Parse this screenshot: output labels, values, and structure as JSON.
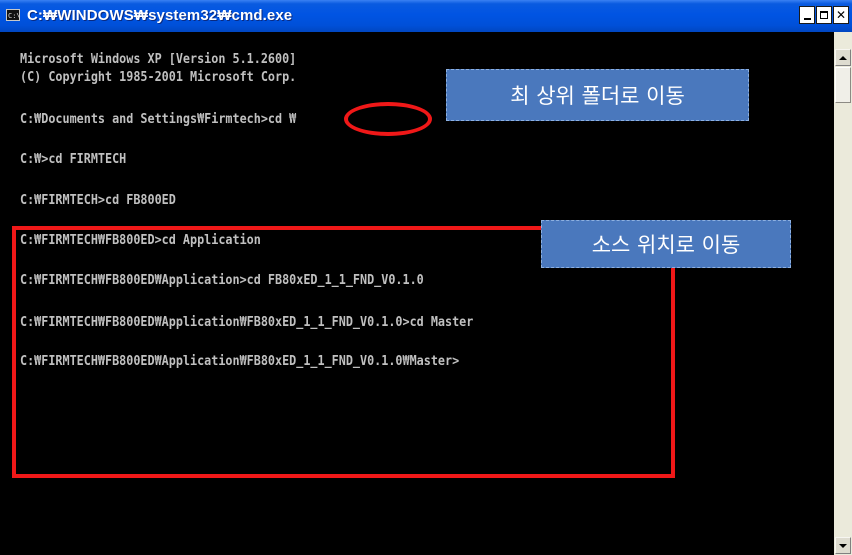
{
  "window": {
    "title": "C:₩WINDOWS₩system32₩cmd.exe",
    "app_icon_text": "C:\\",
    "controls": {
      "minimize": "minimize-icon",
      "maximize": "maximize-icon",
      "close": "close-icon"
    }
  },
  "console": {
    "lines": [
      "Microsoft Windows XP [Version 5.1.2600]",
      "(C) Copyright 1985-2001 Microsoft Corp.",
      "C:₩Documents and Settings₩Firmtech>cd ₩",
      "C:₩>cd FIRMTECH",
      "C:₩FIRMTECH>cd FB800ED",
      "C:₩FIRMTECH₩FB800ED>cd Application",
      "C:₩FIRMTECH₩FB800ED₩Application>cd FB80xED_1_1_FND_V0.1.0",
      "C:₩FIRMTECH₩FB800ED₩Application₩FB80xED_1_1_FND_V0.1.0>cd Master",
      "C:₩FIRMTECH₩FB800ED₩Application₩FB80xED_1_1_FND_V0.1.0₩Master>"
    ]
  },
  "annotations": {
    "callout_top": "최 상위 폴더로 이동",
    "callout_source": "소스 위치로 이동",
    "color": "#f01818",
    "callout_bg": "#4a78bd"
  },
  "colors": {
    "titlebar": "#0054e3",
    "console_bg": "#000000",
    "console_text": "#c0c0c0"
  }
}
